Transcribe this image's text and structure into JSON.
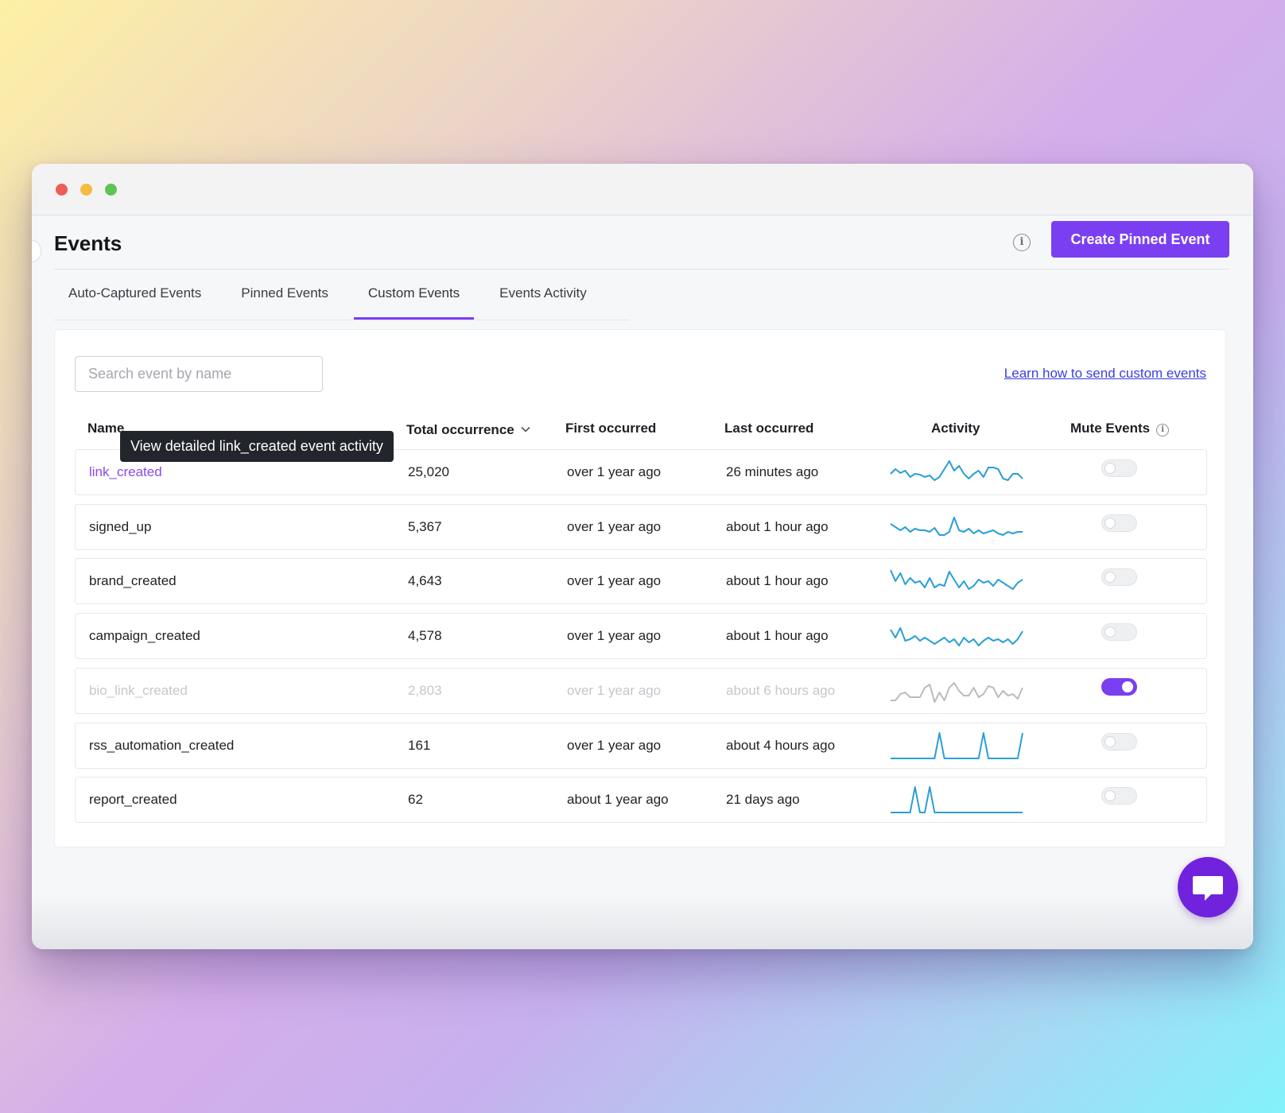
{
  "window": {
    "controls": [
      "close",
      "minimize",
      "maximize"
    ]
  },
  "header": {
    "title": "Events",
    "info_icon": "info-icon",
    "create_button": "Create Pinned Event"
  },
  "tabs": [
    {
      "label": "Auto-Captured Events",
      "active": false
    },
    {
      "label": "Pinned Events",
      "active": false
    },
    {
      "label": "Custom Events",
      "active": true
    },
    {
      "label": "Events Activity",
      "active": false
    }
  ],
  "search": {
    "placeholder": "Search event by name",
    "value": ""
  },
  "learn_link": "Learn how to send custom events",
  "table": {
    "columns": {
      "name": "Name",
      "total": "Total occurrence",
      "first": "First occurred",
      "last": "Last occurred",
      "activity": "Activity",
      "mute": "Mute Events"
    },
    "sort": {
      "column": "total",
      "direction": "desc",
      "icon": "chevron-down-icon"
    },
    "tooltip": "View detailed link_created event activity",
    "rows": [
      {
        "name": "link_created",
        "total": "25,020",
        "first": "over 1 year ago",
        "last": "26 minutes ago",
        "muted": false,
        "hovered": true,
        "activity": [
          14,
          20,
          15,
          18,
          10,
          14,
          13,
          10,
          12,
          6,
          10,
          20,
          30,
          18,
          24,
          14,
          8,
          14,
          18,
          10,
          22,
          22,
          20,
          8,
          6,
          14,
          14,
          8
        ]
      },
      {
        "name": "signed_up",
        "total": "5,367",
        "first": "over 1 year ago",
        "last": "about 1 hour ago",
        "muted": false,
        "hovered": false,
        "activity": [
          20,
          16,
          12,
          16,
          10,
          14,
          12,
          12,
          10,
          15,
          6,
          6,
          10,
          28,
          12,
          10,
          14,
          8,
          12,
          8,
          10,
          12,
          8,
          6,
          10,
          8,
          10,
          10
        ]
      },
      {
        "name": "brand_created",
        "total": "4,643",
        "first": "over 1 year ago",
        "last": "about 1 hour ago",
        "muted": false,
        "hovered": false,
        "activity": [
          30,
          16,
          26,
          12,
          20,
          14,
          16,
          8,
          20,
          8,
          12,
          10,
          28,
          18,
          8,
          16,
          6,
          10,
          18,
          14,
          16,
          10,
          18,
          14,
          10,
          6,
          14,
          18
        ]
      },
      {
        "name": "campaign_created",
        "total": "4,578",
        "first": "over 1 year ago",
        "last": "about 1 hour ago",
        "muted": false,
        "hovered": false,
        "activity": [
          24,
          14,
          26,
          10,
          12,
          16,
          10,
          14,
          10,
          6,
          10,
          14,
          8,
          12,
          4,
          14,
          8,
          12,
          4,
          10,
          14,
          10,
          12,
          8,
          12,
          6,
          12,
          22
        ]
      },
      {
        "name": "bio_link_created",
        "total": "2,803",
        "first": "over 1 year ago",
        "last": "about 6 hours ago",
        "muted": true,
        "hovered": false,
        "activity": [
          4,
          4,
          12,
          14,
          8,
          8,
          8,
          20,
          24,
          2,
          14,
          4,
          20,
          26,
          16,
          10,
          10,
          20,
          8,
          12,
          22,
          20,
          8,
          16,
          10,
          12,
          6,
          20
        ]
      },
      {
        "name": "rss_automation_created",
        "total": "161",
        "first": "over 1 year ago",
        "last": "about 4 hours ago",
        "muted": false,
        "hovered": false,
        "activity": [
          0,
          0,
          0,
          0,
          0,
          0,
          0,
          0,
          0,
          0,
          32,
          0,
          0,
          0,
          0,
          0,
          0,
          0,
          0,
          32,
          0,
          0,
          0,
          0,
          0,
          0,
          0,
          32
        ]
      },
      {
        "name": "report_created",
        "total": "62",
        "first": "about 1 year ago",
        "last": "21 days ago",
        "muted": false,
        "hovered": false,
        "activity": [
          0,
          0,
          0,
          0,
          0,
          32,
          0,
          0,
          32,
          0,
          0,
          0,
          0,
          0,
          0,
          0,
          0,
          0,
          0,
          0,
          0,
          0,
          0,
          0,
          0,
          0,
          0,
          0
        ]
      }
    ]
  },
  "chat_button": "chat-bubble-icon",
  "colors": {
    "accent": "#7b3ff2",
    "sparkline": "#2a9fd6",
    "sparkline_muted": "#bcbcbc",
    "link": "#3b3fe0"
  }
}
